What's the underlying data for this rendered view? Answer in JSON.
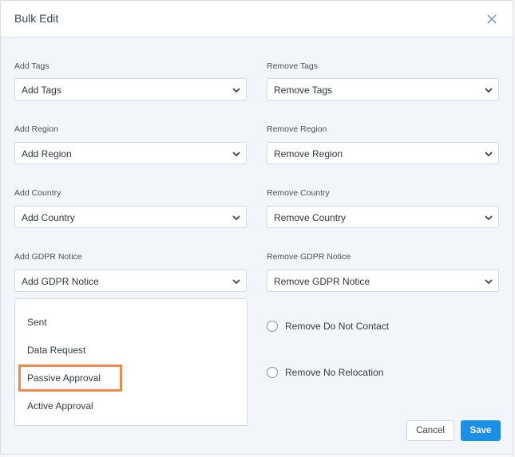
{
  "modal": {
    "title": "Bulk Edit",
    "close_icon": "close-icon"
  },
  "fields": {
    "add_tags": {
      "label": "Add Tags",
      "value": "Add Tags"
    },
    "remove_tags": {
      "label": "Remove Tags",
      "value": "Remove Tags"
    },
    "add_region": {
      "label": "Add Region",
      "value": "Add Region"
    },
    "remove_region": {
      "label": "Remove Region",
      "value": "Remove Region"
    },
    "add_country": {
      "label": "Add Country",
      "value": "Add Country"
    },
    "remove_country": {
      "label": "Remove Country",
      "value": "Remove Country"
    },
    "add_gdpr": {
      "label": "Add GDPR Notice",
      "value": "Add GDPR Notice"
    },
    "remove_gdpr": {
      "label": "Remove GDPR Notice",
      "value": "Remove GDPR Notice"
    }
  },
  "gdpr_dropdown": {
    "options": [
      "Sent",
      "Data Request",
      "Passive Approval",
      "Active Approval"
    ],
    "highlighted": "Passive Approval"
  },
  "radios": {
    "remove_do_not_contact": "Remove Do Not Contact",
    "remove_no_relocation": "Remove No Relocation"
  },
  "buttons": {
    "cancel": "Cancel",
    "save": "Save"
  },
  "colors": {
    "primary": "#1a8fe8",
    "highlight": "#ef8a4b"
  }
}
